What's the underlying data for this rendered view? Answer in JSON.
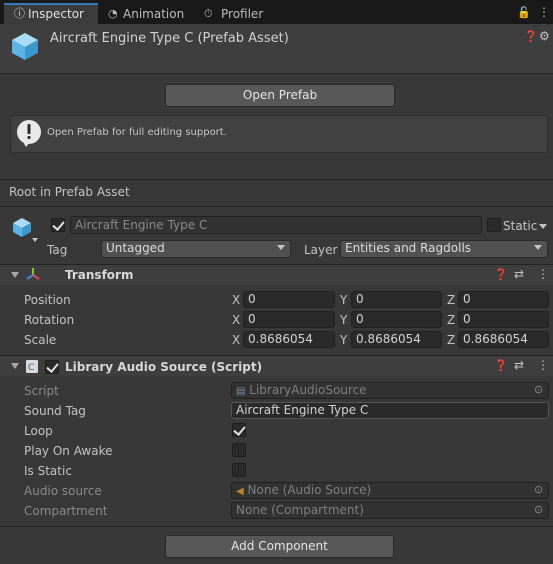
{
  "tabs": [
    {
      "label": "Inspector",
      "icon": "info-icon"
    },
    {
      "label": "Animation",
      "icon": "animation-icon"
    },
    {
      "label": "Profiler",
      "icon": "profiler-icon"
    }
  ],
  "header": {
    "title": "Aircraft Engine Type C (Prefab Asset)"
  },
  "open_prefab_label": "Open Prefab",
  "help_text": "Open Prefab for full editing support.",
  "root_label": "Root in Prefab Asset",
  "object": {
    "name": "Aircraft Engine Type C",
    "static_label": "Static",
    "tag_label": "Tag",
    "tag_value": "Untagged",
    "layer_label": "Layer",
    "layer_value": "Entities and Ragdolls"
  },
  "transform": {
    "title": "Transform",
    "rows": [
      {
        "label": "Position",
        "x": "0",
        "y": "0",
        "z": "0"
      },
      {
        "label": "Rotation",
        "x": "0",
        "y": "0",
        "z": "0"
      },
      {
        "label": "Scale",
        "x": "0.8686054",
        "y": "0.8686054",
        "z": "0.8686054"
      }
    ],
    "axis": {
      "x": "X",
      "y": "Y",
      "z": "Z"
    }
  },
  "audio": {
    "title": "Library Audio Source (Script)",
    "script_label": "Script",
    "script_value": "LibraryAudioSource",
    "sound_tag_label": "Sound Tag",
    "sound_tag_value": "Aircraft Engine Type C",
    "loop_label": "Loop",
    "play_on_awake_label": "Play On Awake",
    "is_static_label": "Is Static",
    "audio_source_label": "Audio source",
    "audio_source_value": "None (Audio Source)",
    "compartment_label": "Compartment",
    "compartment_value": "None (Compartment)",
    "loop_checked": true,
    "play_on_awake_checked": false,
    "is_static_checked": false
  },
  "add_component_label": "Add Component",
  "colors": {
    "accent": "#3a79bb",
    "background": "#383838"
  }
}
